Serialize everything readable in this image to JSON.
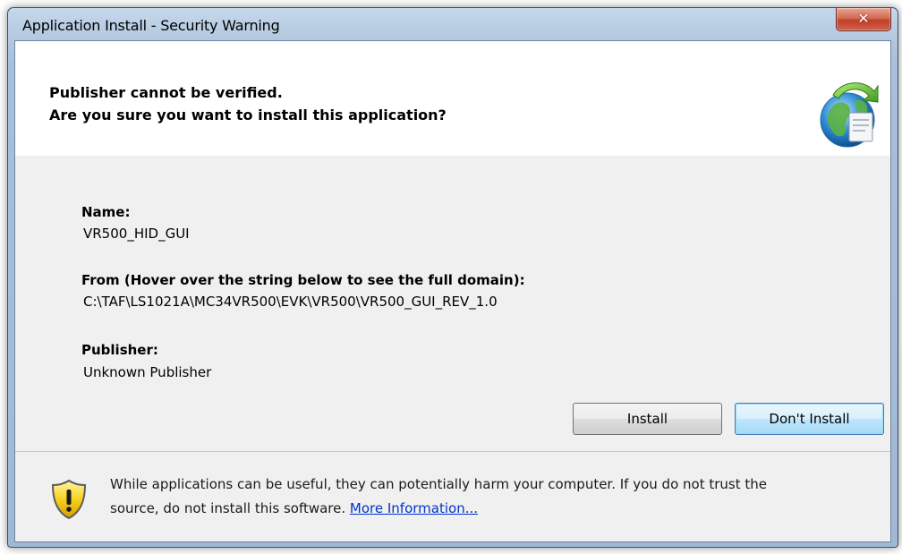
{
  "window": {
    "title": "Application Install - Security Warning"
  },
  "header": {
    "line1": "Publisher cannot be verified.",
    "line2": "Are you sure you want to install this application?"
  },
  "details": {
    "name_label": "Name:",
    "name_value": "VR500_HID_GUI",
    "from_label": "From (Hover over the string below to see the full domain):",
    "from_value": "C:\\TAF\\LS1021A\\MC34VR500\\EVK\\VR500\\VR500_GUI_REV_1.0",
    "publisher_label": "Publisher:",
    "publisher_value": "Unknown Publisher"
  },
  "buttons": {
    "install": "Install",
    "dont_install": "Don't Install"
  },
  "footer": {
    "warning_line1": "While applications can be useful, they can potentially harm your computer. If you do not trust the",
    "warning_line2_prefix": "source, do not install this software.",
    "more_info_link": "More Information..."
  },
  "icons": {
    "close": "close-icon",
    "globe": "globe-install-icon",
    "shield": "warning-shield-icon"
  },
  "colors": {
    "link": "#0033cc",
    "close_button": "#c8483a",
    "default_button_border": "#3c7fb1"
  }
}
